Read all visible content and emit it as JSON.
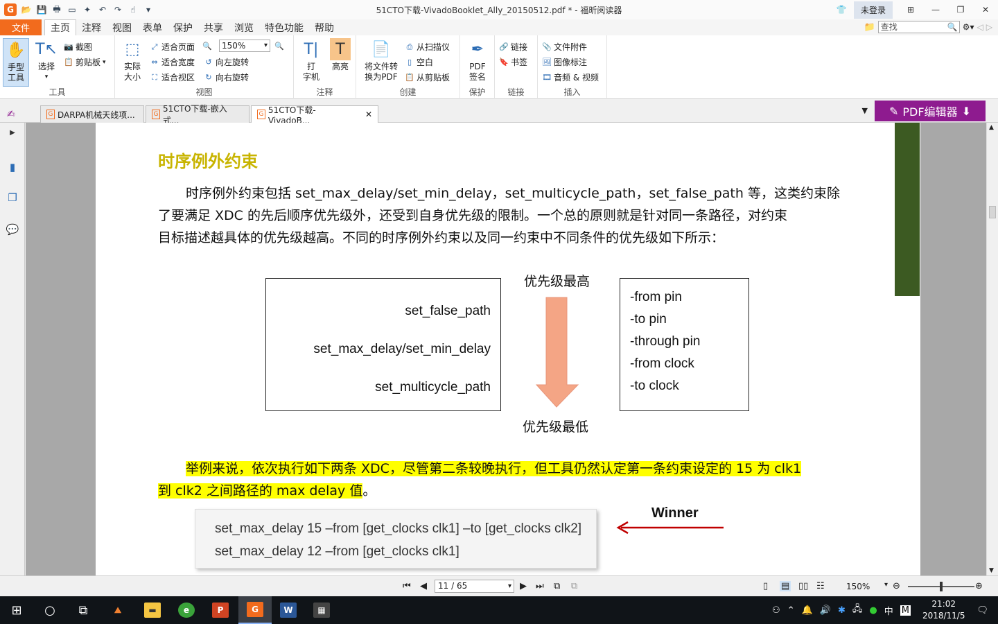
{
  "window": {
    "title": "51CTO下载-VivadoBooklet_Ally_20150512.pdf * - 福昕阅读器",
    "login": "未登录"
  },
  "menu": {
    "file": "文件",
    "tabs": [
      "主页",
      "注释",
      "视图",
      "表单",
      "保护",
      "共享",
      "浏览",
      "特色功能",
      "帮助"
    ],
    "search_placeholder": "查找"
  },
  "ribbon": {
    "tools": {
      "hand": "手型\n工具",
      "hand_l1": "手型",
      "hand_l2": "工具",
      "select": "选择",
      "screenshot": "截图",
      "clipboard": "剪贴板",
      "group": "工具"
    },
    "view": {
      "actual_l1": "实际",
      "actual_l2": "大小",
      "fit_page": "适合页面",
      "fit_width": "适合宽度",
      "fit_view": "适合视区",
      "zoom": "150%",
      "rotate_left": "向左旋转",
      "rotate_right": "向右旋转",
      "group": "视图"
    },
    "comment": {
      "typewriter_l1": "打",
      "typewriter_l2": "字机",
      "highlight": "高亮",
      "group": "注释"
    },
    "create": {
      "convert_l1": "将文件转",
      "convert_l2": "换为PDF",
      "scanner": "从扫描仪",
      "blank": "空白",
      "from_clipboard": "从剪贴板",
      "group": "创建"
    },
    "protect": {
      "sign_l1": "PDF",
      "sign_l2": "签名",
      "group": "保护"
    },
    "links": {
      "link": "链接",
      "bookmark": "书签",
      "group": "链接"
    },
    "insert": {
      "attachment": "文件附件",
      "image": "图像标注",
      "av": "音频 & 视频",
      "group": "插入"
    }
  },
  "doc_tabs": [
    {
      "label": "DARPA机械天线项..."
    },
    {
      "label": "51CTO下载-嵌入式..."
    },
    {
      "label": "51CTO下载-VivadoB..."
    }
  ],
  "pdf_editor": "PDF编辑器",
  "document": {
    "heading": "时序例外约束",
    "para1": [
      "时序例外约束包括 set_max_delay/set_min_delay，set_multicycle_path，set_false_path 等，这类约束除",
      "了要满足 XDC 的先后顺序优先级外，还受到自身优先级的限制。一个总的原则就是针对同一条路径，对约束",
      "目标描述越具体的优先级越高。不同的时序例外约束以及同一约束中不同条件的优先级如下所示："
    ],
    "left_box": [
      "set_false_path",
      "set_max_delay/set_min_delay",
      "set_multicycle_path"
    ],
    "priority_high": "优先级最高",
    "priority_low": "优先级最低",
    "right_box": [
      "-from pin",
      "-to pin",
      "-through pin",
      "-from clock",
      "-to clock"
    ],
    "para2": [
      "举例来说，依次执行如下两条 XDC，尽管第二条较晚执行，但工具仍然认定第一条约束设定的 15 为 clk1",
      "到 clk2 之间路径的 max delay 值",
      "。"
    ],
    "code": [
      "set_max_delay 15 –from [get_clocks clk1] –to [get_clocks clk2]",
      "set_max_delay 12 –from [get_clocks clk1]"
    ],
    "winner": "Winner"
  },
  "status": {
    "page": "11 / 65",
    "zoom": "150%"
  },
  "taskbar": {
    "time": "21:02",
    "date": "2018/11/5",
    "ime": "中",
    "ime2": "M"
  },
  "colors": {
    "accent": "#f26b1d",
    "heading": "#c8b400",
    "highlight": "#ffff00",
    "arrow": "#f4a585",
    "winner_arrow": "#c00000",
    "editor": "#8e1b8f"
  }
}
